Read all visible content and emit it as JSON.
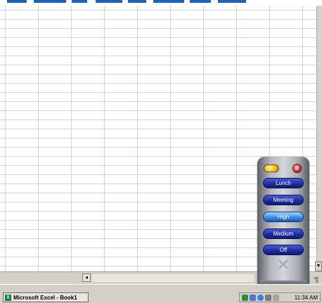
{
  "taskbar": {
    "task_button_label": "Microsoft Excel - Book1",
    "clock": "11:34 AM"
  },
  "widget": {
    "buttons": [
      {
        "label": "Lunch",
        "active": false
      },
      {
        "label": "Meeting",
        "active": false
      },
      {
        "label": "High",
        "active": true
      },
      {
        "label": "Medium",
        "active": false
      },
      {
        "label": "Off",
        "active": false
      }
    ],
    "close_glyph": "×"
  },
  "icons": {
    "excel_app": "excel-icon",
    "close": "close-icon",
    "scroll_left": "scroll-left-icon",
    "scroll_down": "scroll-down-icon",
    "speaker_grille": "speaker-grille-icon",
    "tray": [
      "network-icon",
      "volume-icon",
      "messenger-icon",
      "monitor-icon",
      "printer-icon"
    ]
  },
  "colors": {
    "widget_button": "#1d2a9a",
    "widget_button_active": "#3d8ee6",
    "taskbar": "#d4d0c8",
    "grid_line": "#cfd3da",
    "accent_blue": "#1e63b8"
  }
}
